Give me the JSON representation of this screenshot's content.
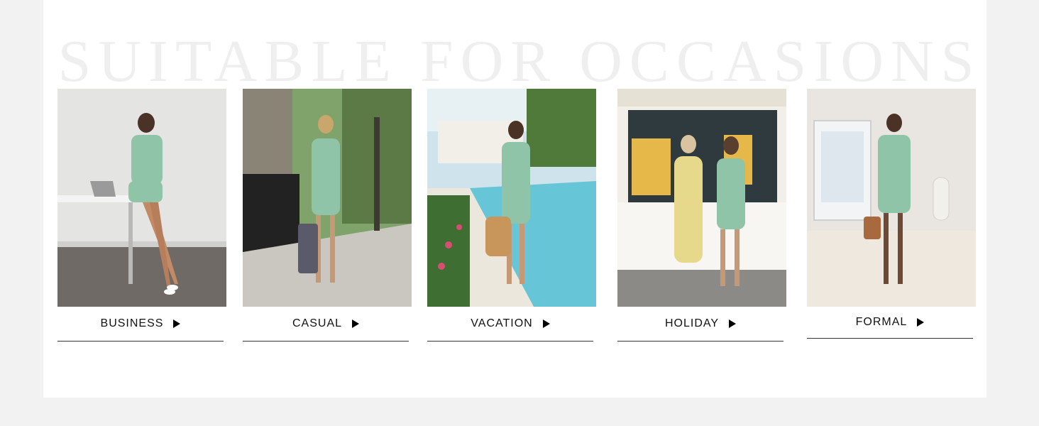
{
  "banner": {
    "title": "SUITABLE FOR OCCASIONS"
  },
  "occasions": [
    {
      "label": "BUSINESS",
      "image": "woman in mint t-shirt dress sitting at a white desk with laptop"
    },
    {
      "label": "CASUAL",
      "image": "woman in mint t-shirt dress walking on a tree-lined sidewalk with tote bag"
    },
    {
      "label": "VACATION",
      "image": "woman in mint t-shirt dress by a swimming pool with straw bag"
    },
    {
      "label": "HOLIDAY",
      "image": "two women in dresses in front of an ice cream kiosk"
    },
    {
      "label": "FORMAL",
      "image": "woman in mint t-shirt dress standing in a marble gallery with handbag"
    }
  ],
  "colors": {
    "dress": "#8fc4a8",
    "page_bg": "#f2f2f2",
    "panel_bg": "#ffffff",
    "title_watermark": "#efefef"
  },
  "icons": {
    "arrow": "play-icon"
  }
}
